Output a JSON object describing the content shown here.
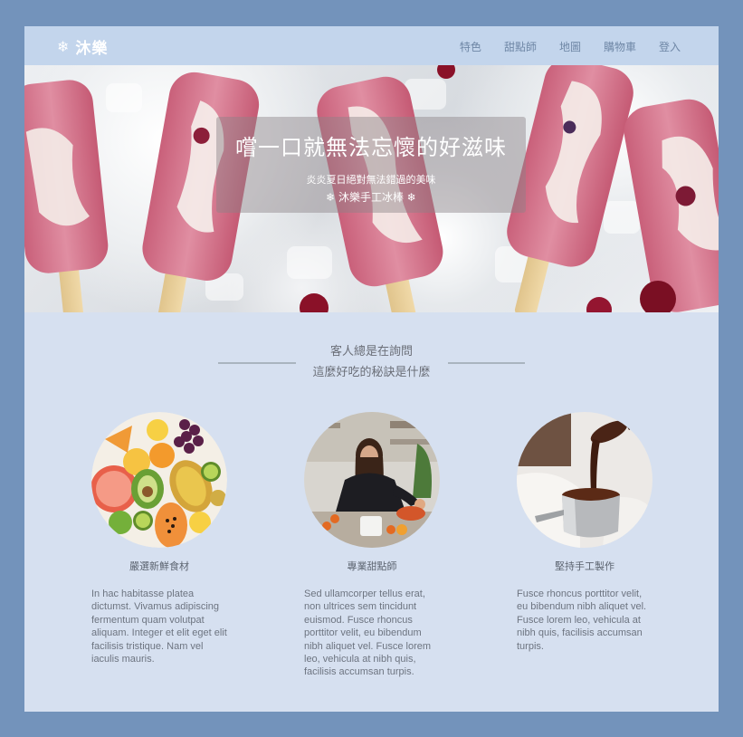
{
  "brand": {
    "icon": "snowflake-icon",
    "glyph": "❄",
    "name": "沐樂"
  },
  "nav": {
    "items": [
      {
        "label": "特色"
      },
      {
        "label": "甜點師"
      },
      {
        "label": "地圖"
      },
      {
        "label": "購物車"
      },
      {
        "label": "登入"
      }
    ]
  },
  "hero": {
    "title": "嚐一口就無法忘懷的好滋味",
    "subtitle": "炎炎夏日絕對無法錯過的美味",
    "tagline": "❄ 沐樂手工冰棒 ❄"
  },
  "section": {
    "line1": "客人總是在詢問",
    "line2": "這麼好吃的秘訣是什麼"
  },
  "features": [
    {
      "title": "嚴選新鮮食材",
      "body": "In hac habitasse platea dictumst. Vivamus adipiscing fermentum quam volutpat aliquam. Integer et elit eget elit facilisis tristique. Nam vel iaculis mauris."
    },
    {
      "title": "專業甜點師",
      "body": "Sed ullamcorper tellus erat, non ultrices sem tincidunt euismod. Fusce rhoncus porttitor velit, eu bibendum nibh aliquet vel. Fusce lorem leo, vehicula at nibh quis, facilisis accumsan turpis."
    },
    {
      "title": "堅持手工製作",
      "body": "Fusce rhoncus porttitor velit, eu bibendum nibh aliquet vel. Fusce lorem leo, vehicula at nibh quis, facilisis accumsan turpis."
    }
  ],
  "colors": {
    "outer_bg": "#7393bb",
    "page_bg": "#d6e0f0",
    "navbar_bg": "#c3d5ec",
    "nav_link": "#6f87a6",
    "popsicle_pink": "#d9788e"
  }
}
